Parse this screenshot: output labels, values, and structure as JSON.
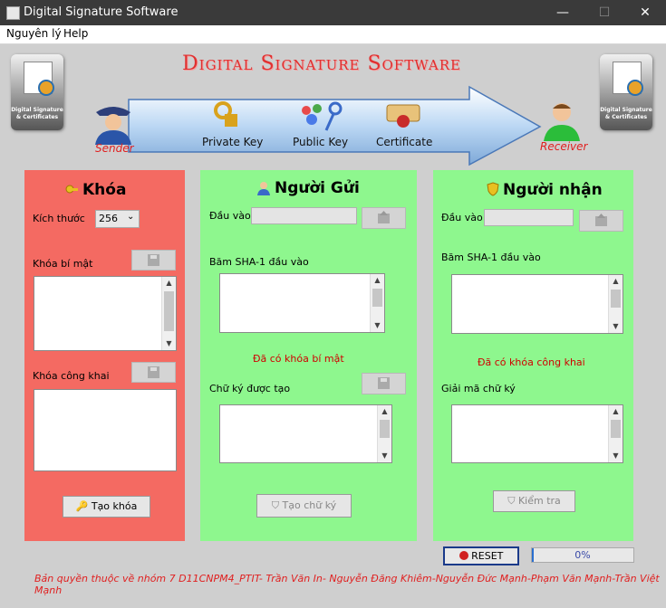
{
  "window": {
    "title": "Digital Signature Software",
    "minimize": "—",
    "maximize": "☐",
    "close": "✕"
  },
  "menu": [
    "Nguyên lý",
    "Help"
  ],
  "header": {
    "title": "Digital Signature Software",
    "cert_label": "Digital Signature & Certificates",
    "sender": "Sender",
    "receiver": "Receiver",
    "items": [
      "Private Key",
      "Public Key",
      "Certificate"
    ]
  },
  "key_panel": {
    "title": "Khóa",
    "size_label": "Kích thước",
    "size_value": "256",
    "private_label": "Khóa bí mật",
    "public_label": "Khóa công khai",
    "generate_button": "Tạo khóa"
  },
  "sender_panel": {
    "title": "Người Gửi",
    "input_label": "Đầu vào",
    "hash_label": "Băm SHA-1 đầu vào",
    "status": "Đã có khóa bí mật",
    "signature_label": "Chữ ký được tạo",
    "sign_button": "Tạo chữ ký"
  },
  "receiver_panel": {
    "title": "Người nhận",
    "input_label": "Đầu vào",
    "hash_label": "Băm SHA-1 đầu vào",
    "status": "Đã có khóa công khai",
    "decrypt_label": "Giải mã chữ ký",
    "verify_button": "Kiểm tra"
  },
  "footer": {
    "reset_button": "RESET",
    "progress": 0,
    "progress_text": "0%",
    "copyright": "Bản quyền thuộc về nhóm 7 D11CNPM4_PTIT- Trần Văn In- Nguyễn Đăng Khiêm-Nguyễn Đức Mạnh-Phạm Văn Mạnh-Trần Việt Mạnh"
  },
  "colors": {
    "key_panel": "#f46a62",
    "green_panel": "#8ef78e",
    "title_red": "#e03030",
    "status_red": "#d00000"
  }
}
